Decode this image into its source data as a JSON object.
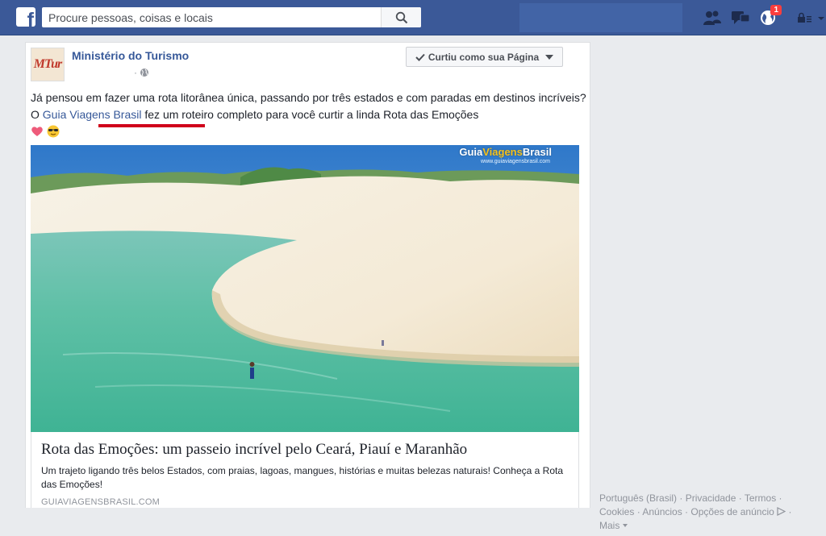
{
  "topbar": {
    "logo": "f",
    "search_placeholder": "Procure pessoas, coisas e locais",
    "notifications_count": "1",
    "icons": [
      "friend-requests-icon",
      "messages-icon",
      "notifications-globe-icon",
      "privacy-lock-icon"
    ]
  },
  "post": {
    "avatar_text": "MTur",
    "page_name": "Ministério do Turismo",
    "meta_separator": "·",
    "liked_button": "Curtiu como sua Página",
    "text_before_link": "Já pensou em fazer uma rota litorânea única, passando por três estados e com paradas em destinos incríveis? O ",
    "text_link": "Guia Viagens Brasil",
    "text_after_link": " fez um roteiro completo para você curtir a linda Rota das Emoções",
    "emojis": [
      "heart-emoji",
      "sunglasses-emoji"
    ],
    "image_watermark_prefix": "Guia",
    "image_watermark_highlight": "Viagens",
    "image_watermark_suffix": "Brasil",
    "image_watermark_url": "www.guiaviagensbrasil.com",
    "link_title": "Rota das Emoções: um passeio incrível pelo Ceará, Piauí e Maranhão",
    "link_description": "Um trajeto ligando três belos Estados, com praias, lagoas, mangues, histórias e muitas belezas naturais! Conheça a Rota das Emoções!",
    "link_domain": "GUIAVIAGENSBRASIL.COM"
  },
  "footer": {
    "line1": "Português (Brasil) · Privacidade · Termos ·",
    "line2": "Cookies · Anúncios · Opções de anúncio",
    "line2_end": " ·",
    "line3": "Mais"
  },
  "colors": {
    "brand_blue": "#3b5998",
    "link_blue": "#365899",
    "highlight_red": "#d0021b"
  }
}
